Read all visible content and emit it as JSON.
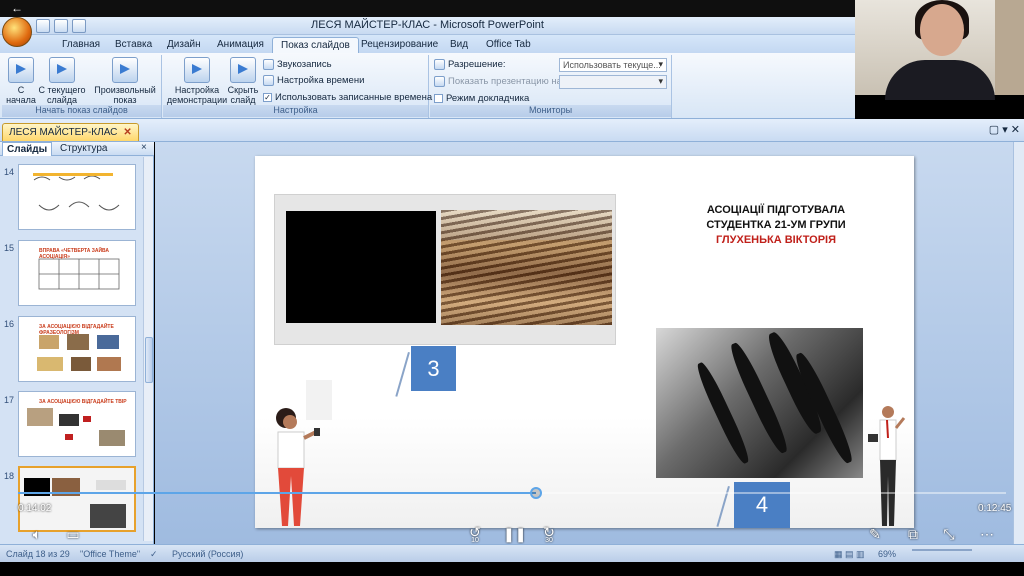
{
  "window": {
    "title": "ЛЕСЯ МАЙСТЕР-КЛАС - Microsoft PowerPoint"
  },
  "ribbon_tabs": [
    "Главная",
    "Вставка",
    "Дизайн",
    "Анимация",
    "Показ слайдов",
    "Рецензирование",
    "Вид",
    "Office Tab"
  ],
  "ribbon": {
    "group1": {
      "label": "Начать показ слайдов",
      "btn1": "С начала",
      "btn2": "С текущего слайда",
      "btn3": "Произвольный показ"
    },
    "group2": {
      "label": "Настройка",
      "btn1": "Настройка демонстрации",
      "btn2": "Скрыть слайд",
      "record": "Звукозапись",
      "timing": "Настройка времени",
      "use_timing": "Использовать записанные времена"
    },
    "group3": {
      "label": "Мониторы",
      "resolution": "Разрешение:",
      "resolution_value": "Использовать текуще...",
      "show_on": "Показать презентацию на:",
      "presenter": "Режим докладчика"
    }
  },
  "doc_tab": {
    "label": "ЛЕСЯ МАЙСТЕР-КЛАС"
  },
  "panel": {
    "tab_slides": "Слайды",
    "tab_outline": "Структура",
    "thumbs": [
      {
        "num": "14",
        "title": ""
      },
      {
        "num": "15",
        "title": "ВПРАВА «ЧЕТВЕРТА ЗАЙВА АСОЦІАЦІЯ»"
      },
      {
        "num": "16",
        "title": "ЗА АСОЦІАЦІЄЮ ВІДГАДАЙТЕ ФРАЗЕОЛОГІЗМ"
      },
      {
        "num": "17",
        "title": "ЗА АСОЦІАЦІЄЮ ВІДГАДАЙТЕ ТВІР"
      },
      {
        "num": "18",
        "title": ""
      }
    ]
  },
  "slide": {
    "caption_line1": "АСОЦІАЦІЇ ПІДГОТУВАЛА",
    "caption_line2": "СТУДЕНТКА 21-УМ ГРУПИ",
    "caption_line3": "ГЛУХЕНЬКА ВІКТОРІЯ",
    "num3": "3",
    "num4": "4"
  },
  "video": {
    "elapsed": "0:14:02",
    "duration": "0:12:45",
    "progress": 0.524,
    "rewind": "10",
    "forward": "30"
  },
  "status": {
    "slide": "Слайд 18 из 29",
    "theme": "\"Office Theme\"",
    "lang": "Русский (Россия)",
    "zoom": "69%"
  }
}
